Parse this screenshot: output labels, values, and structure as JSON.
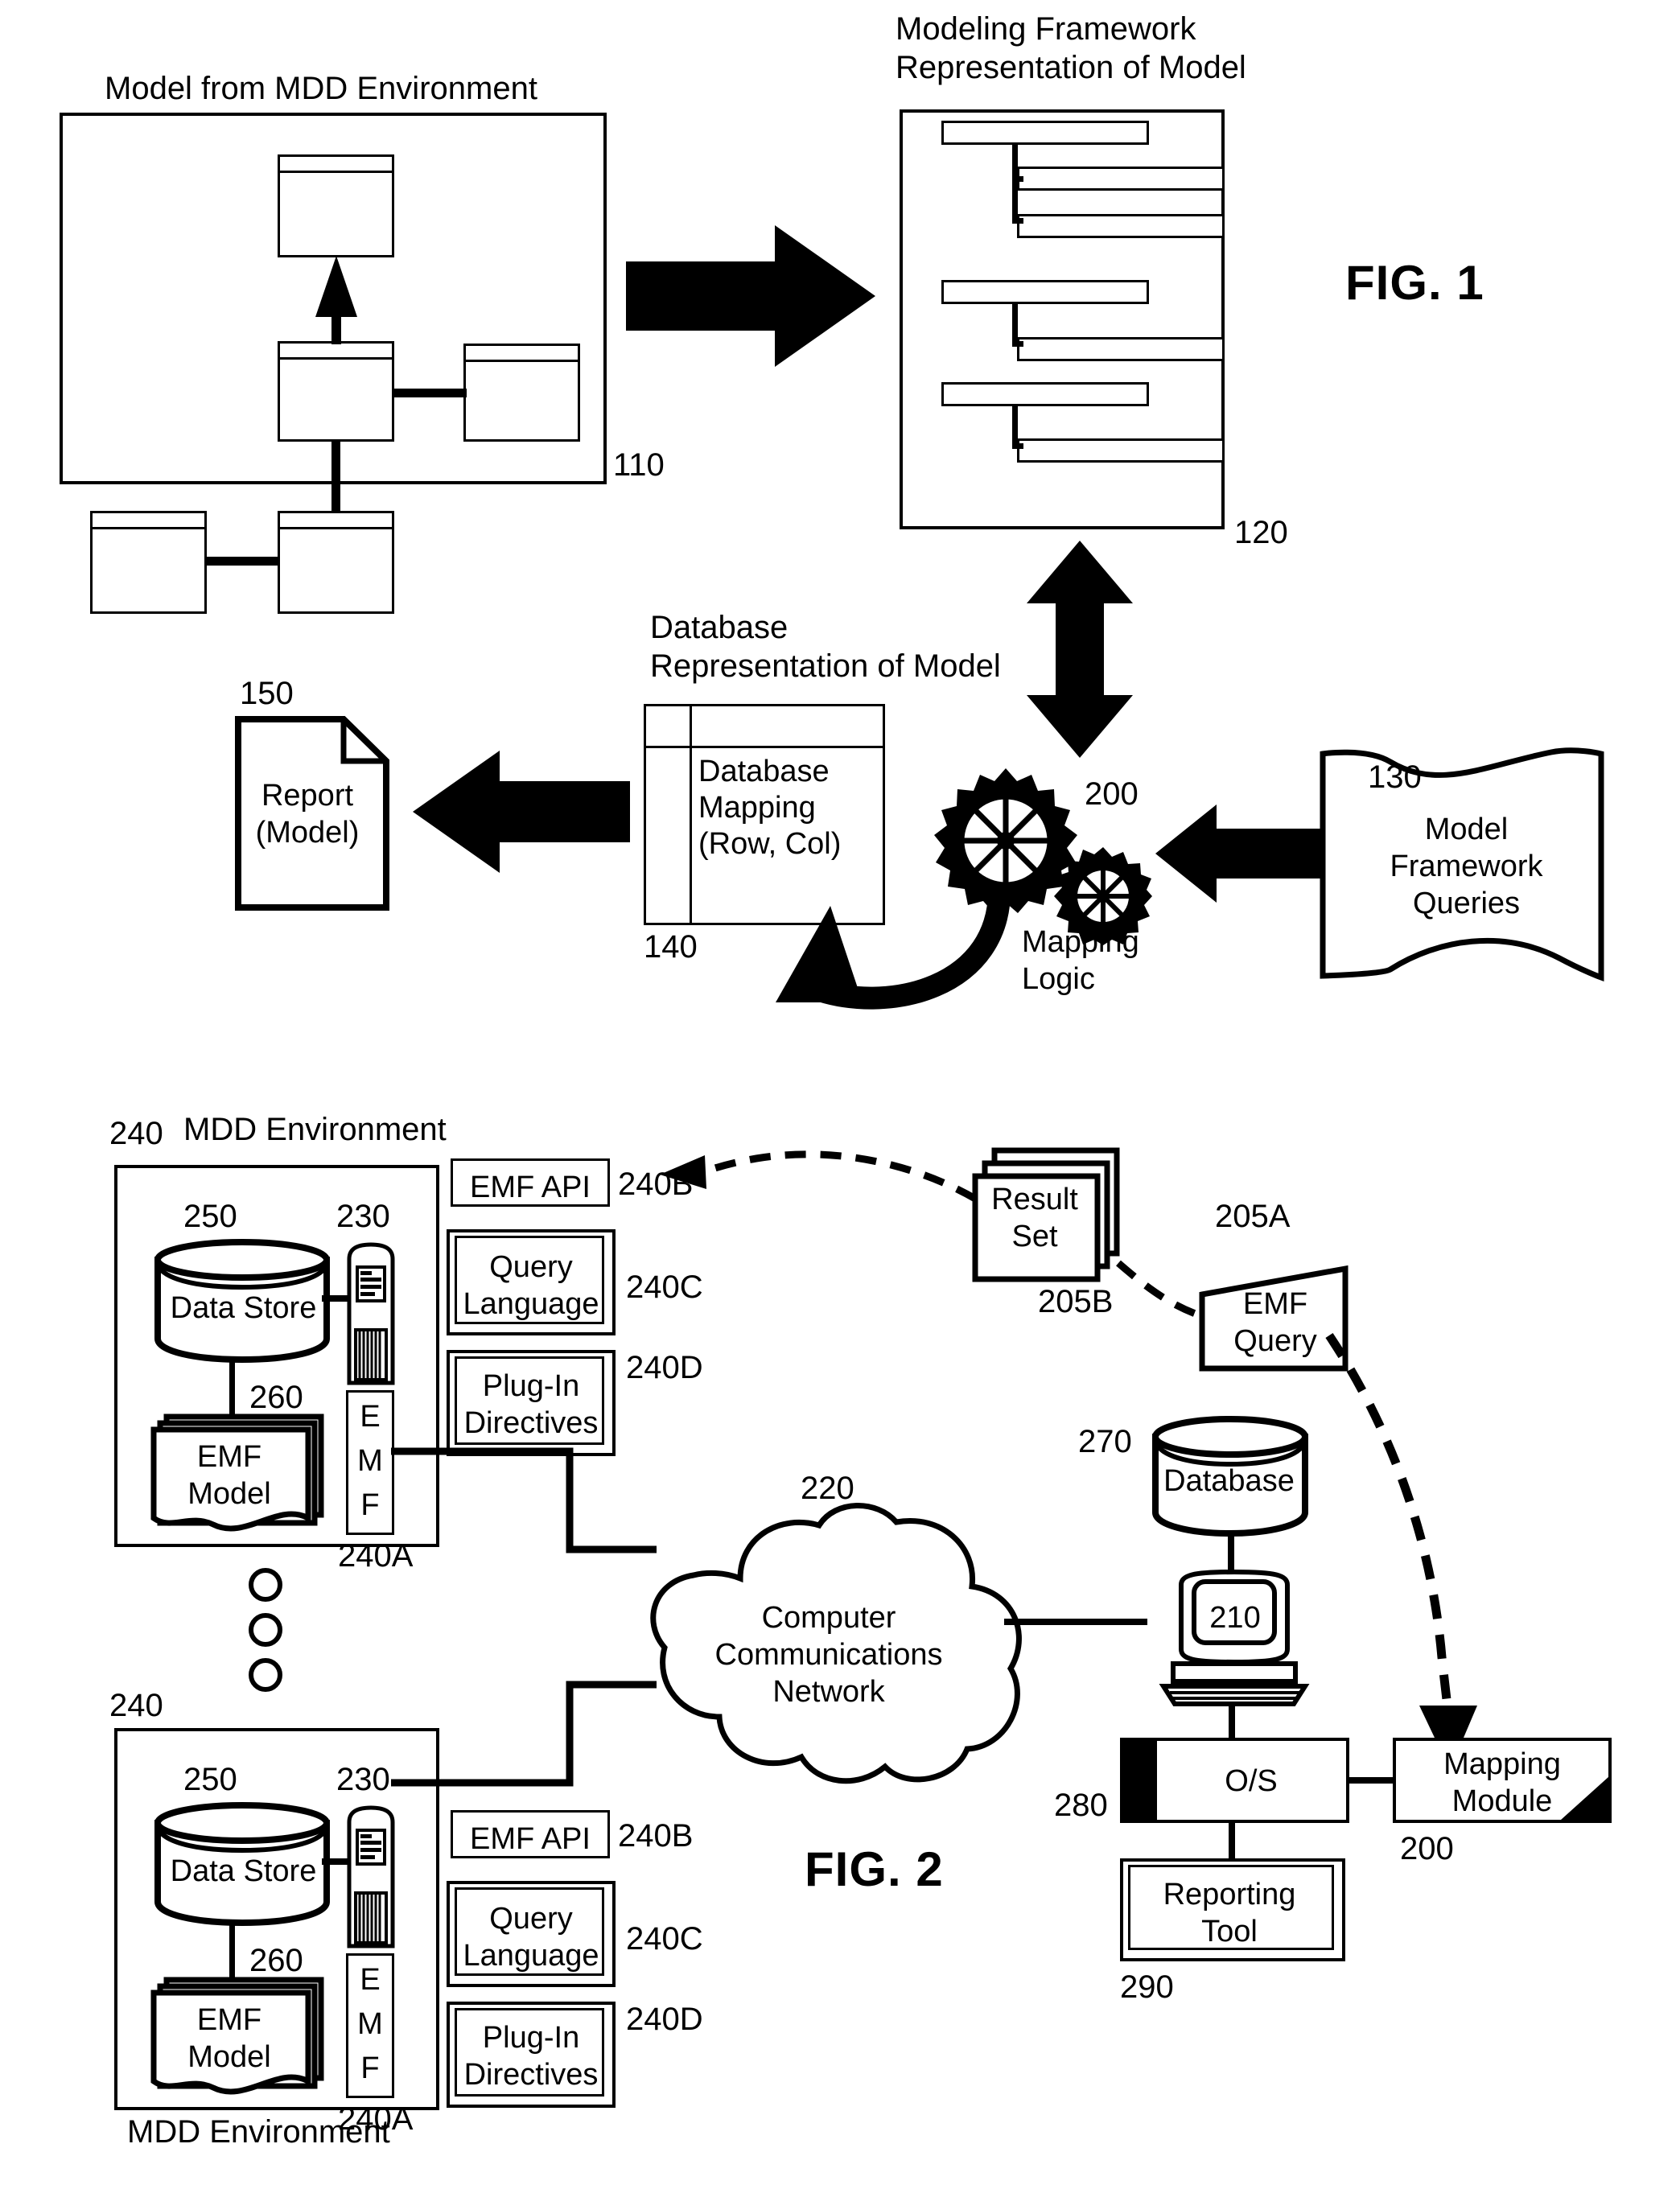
{
  "figure1": {
    "fig_label": "FIG. 1",
    "model_box": {
      "caption": "Model from MDD Environment",
      "ref": "110"
    },
    "framework_box": {
      "caption_line1": "Modeling Framework",
      "caption_line2": "Representation of Model",
      "ref": "120"
    },
    "database_box": {
      "caption_line1": "Database",
      "caption_line2": "Representation of Model",
      "label_line1": "Database",
      "label_line2": "Mapping",
      "label_line3": "(Row, Col)",
      "ref": "140"
    },
    "report": {
      "label_line1": "Report",
      "label_line2": "(Model)",
      "ref": "150"
    },
    "mapping_logic": {
      "label_line1": "Mapping",
      "label_line2": "Logic",
      "ref": "200"
    },
    "queries": {
      "label_line1": "Model",
      "label_line2": "Framework",
      "label_line3": "Queries",
      "ref": "130"
    }
  },
  "figure2": {
    "fig_label": "FIG. 2",
    "mdd_top": {
      "title": "MDD Environment",
      "ref": "240",
      "data_store": {
        "label": "Data Store",
        "ref": "250"
      },
      "server": {
        "ref": "230"
      },
      "emf_model": {
        "label_line1": "EMF",
        "label_line2": "Model",
        "ref": "260"
      },
      "emf_column": {
        "letters": "E\nM\nF",
        "ref": "240A"
      },
      "emf_api": {
        "label": "EMF API",
        "ref": "240B"
      },
      "query_language": {
        "label_line1": "Query",
        "label_line2": "Language",
        "ref": "240C"
      },
      "plugin_directives": {
        "label_line1": "Plug-In",
        "label_line2": "Directives",
        "ref": "240D"
      }
    },
    "mdd_bottom": {
      "title": "MDD Environment",
      "ref": "240",
      "data_store": {
        "label": "Data Store",
        "ref": "250"
      },
      "server": {
        "ref": "230"
      },
      "emf_model": {
        "label_line1": "EMF",
        "label_line2": "Model",
        "ref": "260"
      },
      "emf_column": {
        "letters": "E\nM\nF",
        "ref": "240A"
      },
      "emf_api": {
        "label": "EMF API",
        "ref": "240B"
      },
      "query_language": {
        "label_line1": "Query",
        "label_line2": "Language",
        "ref": "240C"
      },
      "plugin_directives": {
        "label_line1": "Plug-In",
        "label_line2": "Directives",
        "ref": "240D"
      }
    },
    "network": {
      "label_line1": "Computer",
      "label_line2": "Communications",
      "label_line3": "Network",
      "ref": "220"
    },
    "result_set": {
      "label_line1": "Result",
      "label_line2": "Set",
      "ref": "205B"
    },
    "emf_query": {
      "label_line1": "EMF",
      "label_line2": "Query",
      "ref": "205A"
    },
    "database": {
      "label": "Database",
      "ref": "270"
    },
    "computer": {
      "ref": "210"
    },
    "os": {
      "label": "O/S",
      "ref": "280"
    },
    "mapping_module": {
      "label_line1": "Mapping",
      "label_line2": "Module",
      "ref": "200"
    },
    "reporting_tool": {
      "label_line1": "Reporting",
      "label_line2": "Tool",
      "ref": "290"
    }
  }
}
